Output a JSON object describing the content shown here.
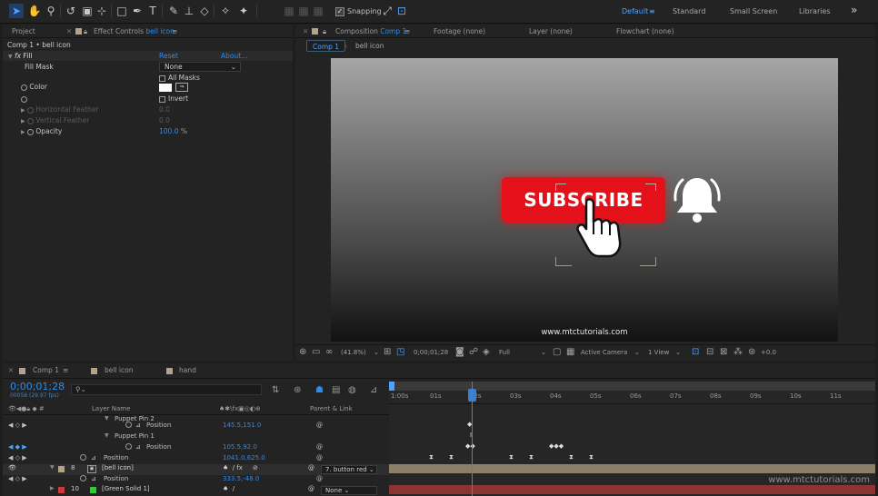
{
  "toolbar": {
    "snapping_label": "Snapping",
    "workspaces": [
      "Default",
      "Standard",
      "Small Screen",
      "Libraries"
    ],
    "overflow": "»"
  },
  "left_panel": {
    "tabs": {
      "project": "Project",
      "effect_controls_prefix": "Effect Controls",
      "effect_controls_layer": "bell icon"
    },
    "breadcrumb": "Comp 1 • bell icon",
    "effect": {
      "fx": "fx",
      "name": "Fill",
      "reset": "Reset",
      "about": "About..."
    },
    "fill_mask": {
      "label": "Fill Mask",
      "value": "None"
    },
    "all_masks": "All Masks",
    "color_label": "Color",
    "invert": "Invert",
    "horizontal_feather": {
      "label": "Horizontal Feather",
      "value": "0.0"
    },
    "vertical_feather": {
      "label": "Vertical Feather",
      "value": "0.0"
    },
    "opacity": {
      "label": "Opacity",
      "value": "100.0",
      "unit": "%"
    }
  },
  "comp_panel": {
    "tabs": {
      "composition_prefix": "Composition",
      "composition_name": "Comp 1",
      "footage": "Footage (none)",
      "layer": "Layer (none)",
      "flowchart": "Flowchart (none)"
    },
    "breadcrumb": {
      "comp": "Comp 1",
      "layer": "bell icon"
    },
    "viewer": {
      "subscribe": "SUBSCRIBE",
      "url": "www.mtctutorials.com"
    },
    "controls": {
      "zoom": "(41.8%)",
      "timecode": "0;00;01;28",
      "resolution": "Full",
      "camera": "Active Camera",
      "views": "1 View",
      "exposure": "+0.0"
    }
  },
  "timeline": {
    "tabs": [
      "Comp 1",
      "bell icon",
      "hand"
    ],
    "timecode": "0;00;01;28",
    "fps": "00058 (29.97 fps)",
    "headers": {
      "layer_name": "Layer Name",
      "parent": "Parent & Link"
    },
    "ruler": [
      "1:00s",
      "01s",
      "02s",
      "03s",
      "04s",
      "05s",
      "06s",
      "07s",
      "08s",
      "09s",
      "10s",
      "11s"
    ],
    "rows": {
      "pin2": "Puppet Pin 2",
      "pos1": {
        "label": "Position",
        "value": "145.5,151.0"
      },
      "pin1": "Puppet Pin 1",
      "pos2": {
        "label": "Position",
        "value": "105.5,92.0"
      },
      "pos3": {
        "label": "Position",
        "value": "1041.0,625.0"
      },
      "layer8": {
        "num": "8",
        "name": "[bell icon]",
        "parent": "7. button red"
      },
      "pos4": {
        "label": "Position",
        "value": "333.5,-48.0"
      },
      "layer10": {
        "num": "10",
        "name": "[Green Solid 1]",
        "parent": "None"
      }
    },
    "watermark": "www.mtctutorials.com"
  },
  "colors": {
    "accent": "#2d8ceb",
    "subscribe_red": "#e4101a",
    "label_tan": "#b5a387",
    "label_green": "#25d02a",
    "label_red": "#c93a3a"
  }
}
